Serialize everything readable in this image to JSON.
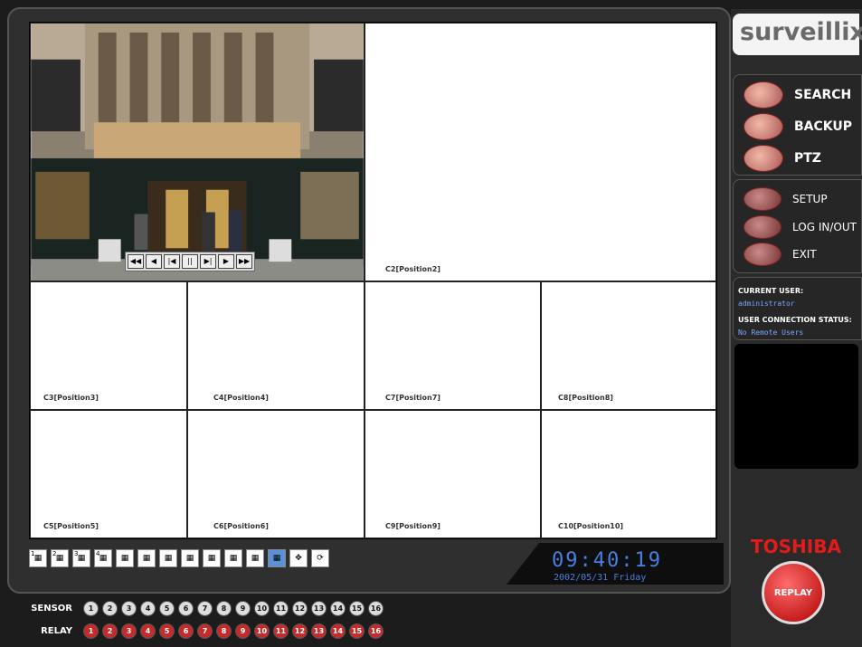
{
  "brand": {
    "logo": "surveillix",
    "manufacturer": "TOSHIBA"
  },
  "tiles": [
    {
      "label": "C2[Position2]"
    },
    {
      "label": "C3[Position3]"
    },
    {
      "label": "C4[Position4]"
    },
    {
      "label": "C7[Position7]"
    },
    {
      "label": "C8[Position8]"
    },
    {
      "label": "C5[Position5]"
    },
    {
      "label": "C6[Position6]"
    },
    {
      "label": "C9[Position9]"
    },
    {
      "label": "C10[Position10]"
    }
  ],
  "playback": {
    "buttons": [
      "◀◀",
      "◀",
      "|◀",
      "||",
      "▶|",
      "▶",
      "▶▶"
    ]
  },
  "layout_buttons": [
    "1",
    "2",
    "3",
    "4",
    "5",
    "6",
    "7",
    "8",
    "9",
    "10",
    "11",
    "12",
    "13",
    "14"
  ],
  "clock": {
    "time": "09:40:19",
    "date": "2002/05/31  Friday"
  },
  "menu": {
    "search": "SEARCH",
    "backup": "BACKUP",
    "ptz": "PTZ",
    "setup": "SETUP",
    "login": "LOG IN/OUT",
    "exit": "EXIT"
  },
  "status": {
    "current_user_label": "CURRENT USER:",
    "current_user": "administrator",
    "connection_label": "USER CONNECTION STATUS:",
    "connection": "No Remote Users"
  },
  "replay": "REPLAY",
  "io": {
    "sensor_label": "SENSOR",
    "relay_label": "RELAY",
    "numbers": [
      "1",
      "2",
      "3",
      "4",
      "5",
      "6",
      "7",
      "8",
      "9",
      "10",
      "11",
      "12",
      "13",
      "14",
      "15",
      "16"
    ]
  },
  "colors": {
    "clock": "#4a7fe0",
    "relay": "#c62b2b",
    "brand_red": "#e21b1b",
    "active_layout": "#5b8fd6"
  }
}
